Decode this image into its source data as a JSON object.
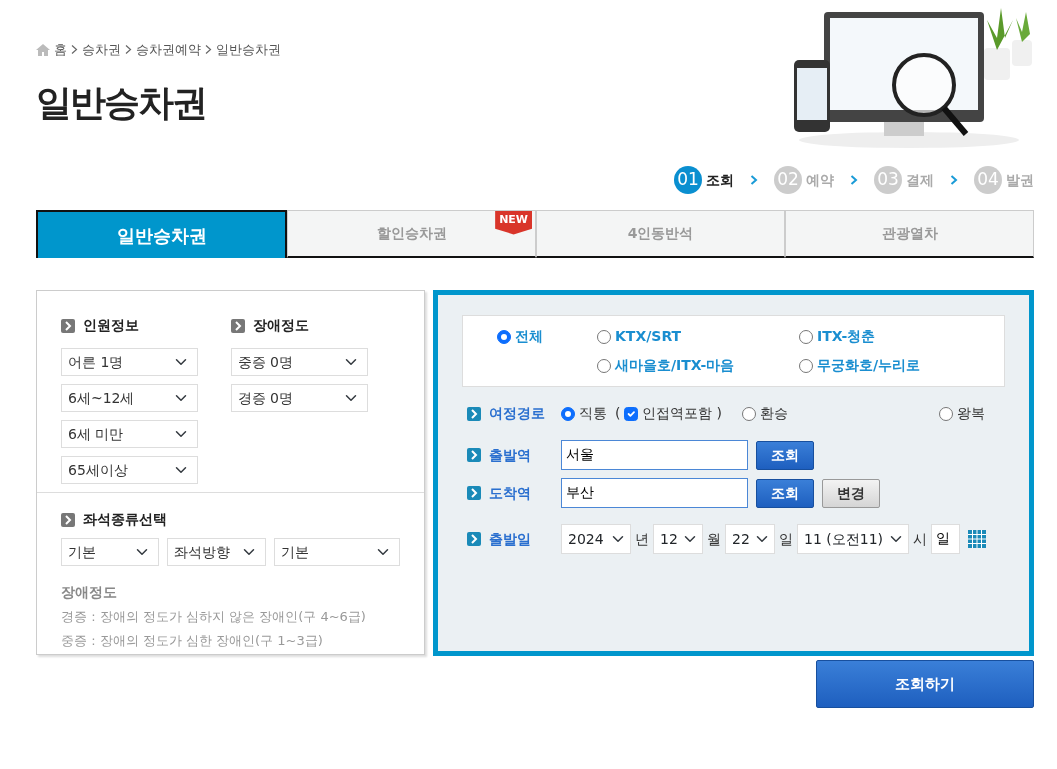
{
  "breadcrumb": [
    "홈",
    "승차권",
    "승차권예약",
    "일반승차권"
  ],
  "title": "일반승차권",
  "banner": {
    "kind": "picture"
  },
  "steps": [
    {
      "number": "01",
      "label": "조회",
      "selected": true
    },
    {
      "number": "02",
      "label": "예약",
      "selected": false
    },
    {
      "number": "03",
      "label": "결제",
      "selected": false
    },
    {
      "number": "04",
      "label": "발권",
      "selected": false
    }
  ],
  "tabs": [
    {
      "label": "일반승차권",
      "selected": true
    },
    {
      "label": "할인승차권",
      "selected": false,
      "badge": "NEW"
    },
    {
      "label": "4인동반석",
      "selected": false
    },
    {
      "label": "관광열차",
      "selected": false
    }
  ],
  "passengers": {
    "title": "인원정보",
    "selects": [
      "어른 1명",
      "6세~12세",
      "6세 미만",
      "65세이상"
    ]
  },
  "disability": {
    "title": "장애정도",
    "selects": [
      "중증 0명",
      "경증 0명"
    ]
  },
  "seat_type": {
    "title": "좌석종류선택",
    "selects": [
      "기본",
      "좌석방향",
      "기본"
    ]
  },
  "disability_note": {
    "title": "장애정도",
    "lines": [
      "경증 : 장애의 정도가 심하지 않은 장애인(구 4~6급)",
      "중증 : 장애의 정도가 심한 장애인(구 1~3급)"
    ]
  },
  "train_types": [
    {
      "label": "전체",
      "selected": true
    },
    {
      "label": "KTX/SRT",
      "selected": false
    },
    {
      "label": "ITX-청춘",
      "selected": false
    },
    {
      "label": "새마을호/ITX-마음",
      "selected": false
    },
    {
      "label": "무궁화호/누리로",
      "selected": false
    }
  ],
  "route": {
    "label": "여정경로",
    "options": [
      {
        "label": "직통",
        "selected": true
      },
      {
        "label": "환승",
        "selected": false
      },
      {
        "label": "왕복",
        "selected": false
      }
    ],
    "nearby": {
      "open": "(",
      "label": "인접역포함",
      "close": ")",
      "checked": true
    }
  },
  "departure": {
    "label": "출발역",
    "value": "서울",
    "button": "조회"
  },
  "arrival": {
    "label": "도착역",
    "value": "부산",
    "button": "조회",
    "extra_button": "변경"
  },
  "date": {
    "label": "출발일",
    "fields": [
      {
        "value": "2024",
        "unit": "년"
      },
      {
        "value": "12",
        "unit": "월"
      },
      {
        "value": "22",
        "unit": "일"
      },
      {
        "value": "11 (오전11)",
        "unit": "시"
      }
    ],
    "extra_field": "일"
  },
  "submit": "조회하기"
}
